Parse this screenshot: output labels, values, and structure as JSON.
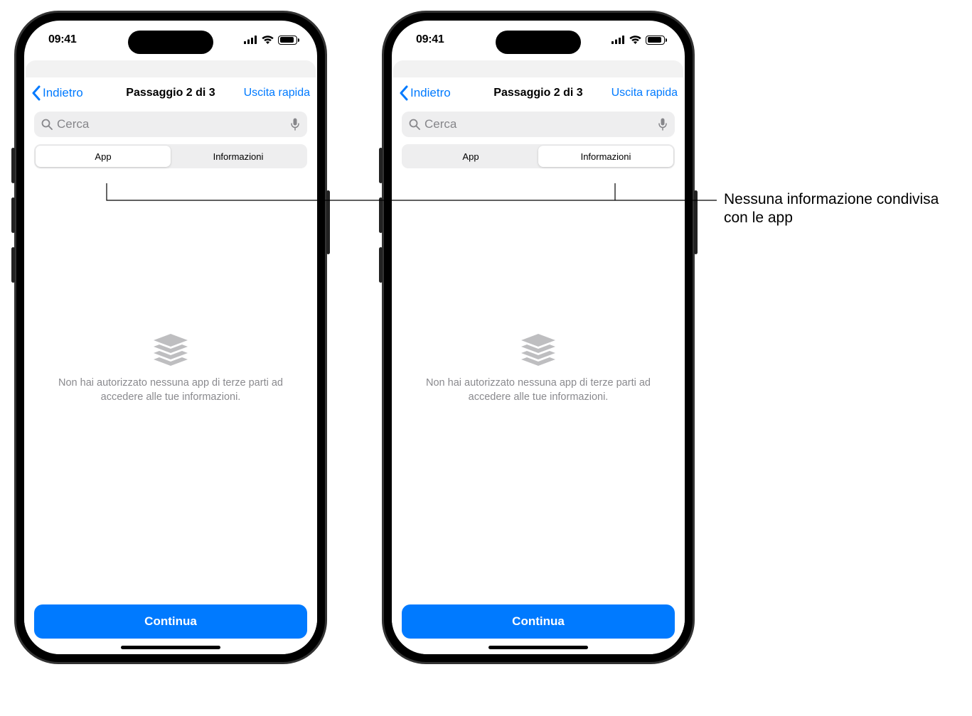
{
  "status": {
    "time": "09:41"
  },
  "nav": {
    "back": "Indietro",
    "title": "Passaggio 2 di 3",
    "quick_exit": "Uscita rapida"
  },
  "search": {
    "placeholder": "Cerca"
  },
  "segments": {
    "app": "App",
    "info": "Informazioni"
  },
  "empty": {
    "message": "Non hai autorizzato nessuna app di terze parti ad accedere alle tue informazioni."
  },
  "buttons": {
    "continue": "Continua"
  },
  "callout": {
    "text": "Nessuna informazione condivisa con le app"
  }
}
